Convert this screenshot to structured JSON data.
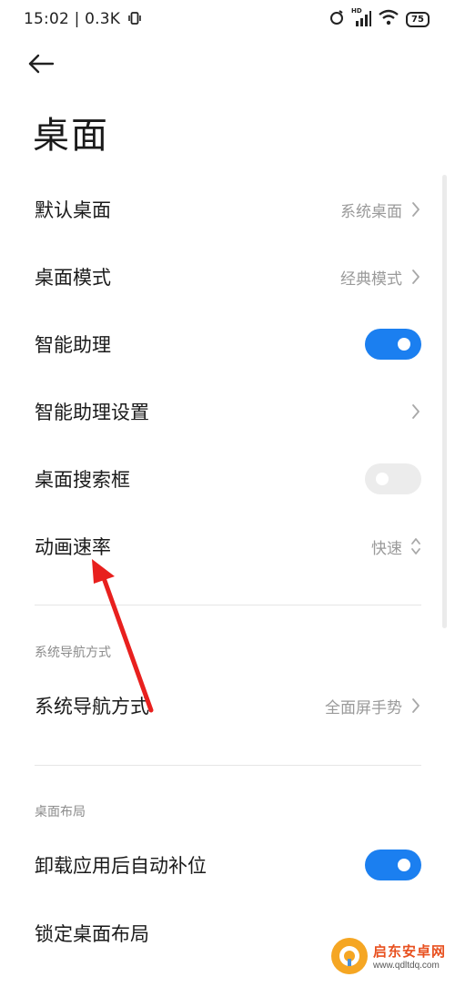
{
  "status_bar": {
    "time": "15:02",
    "speed": "0.3K",
    "signal_tag": "HD",
    "battery": "75"
  },
  "page": {
    "title": "桌面"
  },
  "rows": [
    {
      "label": "默认桌面",
      "value": "系统桌面",
      "control": "chevron-right"
    },
    {
      "label": "桌面模式",
      "value": "经典模式",
      "control": "chevron-right"
    },
    {
      "label": "智能助理",
      "control": "toggle",
      "toggle_on": true
    },
    {
      "label": "智能助理设置",
      "control": "chevron-right"
    },
    {
      "label": "桌面搜索框",
      "control": "toggle",
      "toggle_on": false
    },
    {
      "label": "动画速率",
      "value": "快速",
      "control": "chevron-up-down"
    }
  ],
  "sections": [
    {
      "header": "系统导航方式",
      "rows": [
        {
          "label": "系统导航方式",
          "value": "全面屏手势",
          "control": "chevron-right"
        }
      ]
    },
    {
      "header": "桌面布局",
      "rows": [
        {
          "label": "卸载应用后自动补位",
          "control": "toggle",
          "toggle_on": true
        },
        {
          "label": "锁定桌面布局"
        }
      ]
    }
  ],
  "annotation": {
    "arrow_color": "#e8201e"
  },
  "watermark": {
    "name": "启东安卓网",
    "url": "www.qdltdq.com"
  },
  "colors": {
    "accent": "#1b7ff0",
    "toggle_off": "#ececec",
    "secondary_text": "#9a9a9a"
  }
}
